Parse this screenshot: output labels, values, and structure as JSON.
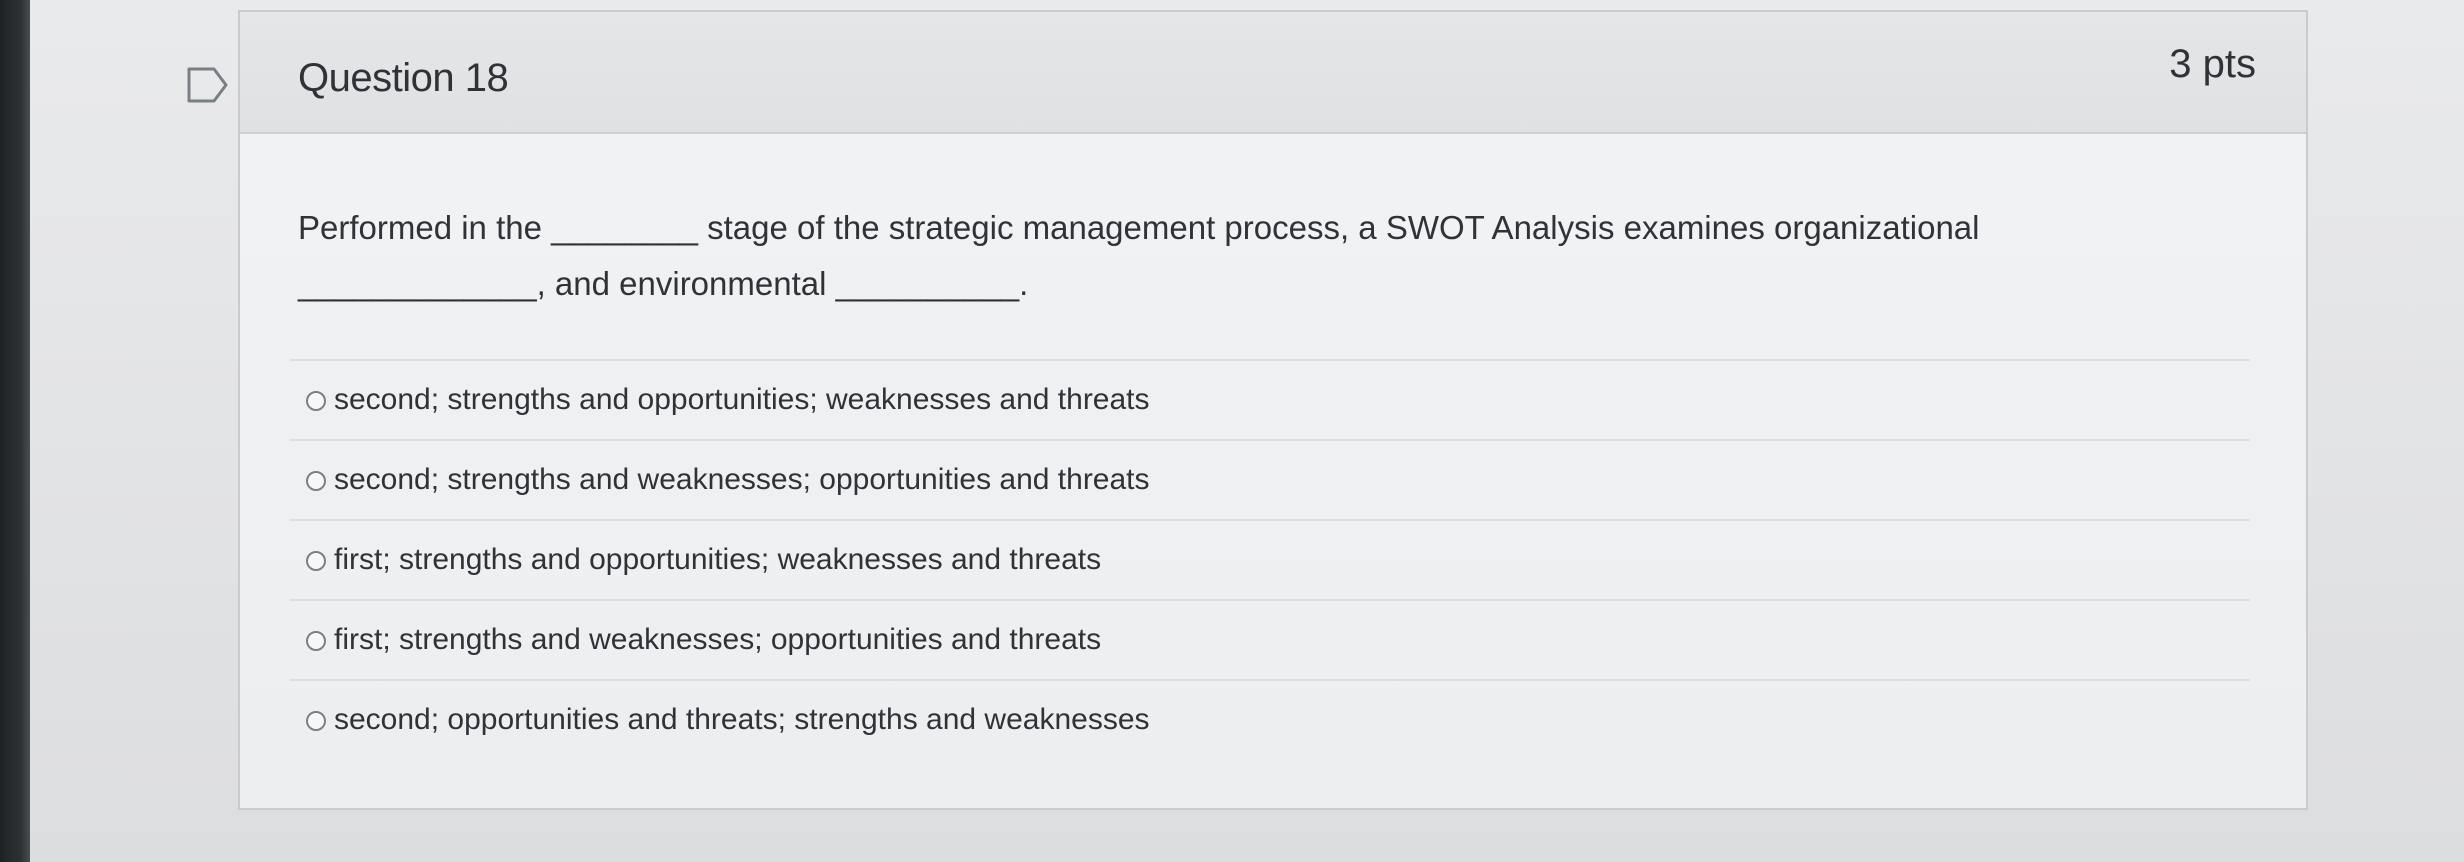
{
  "question": {
    "title": "Question 18",
    "points": "3 pts",
    "prompt": "Performed in the ________ stage of the strategic management process, a SWOT Analysis examines organizational\n_____________, and environmental __________.",
    "answers": [
      {
        "label": "second; strengths and opportunities; weaknesses and threats",
        "selected": false
      },
      {
        "label": "second; strengths and weaknesses; opportunities and threats",
        "selected": false
      },
      {
        "label": "first; strengths and opportunities; weaknesses and threats",
        "selected": false
      },
      {
        "label": "first; strengths and weaknesses; opportunities and threats",
        "selected": false
      },
      {
        "label": "second; opportunities and threats; strengths and weaknesses",
        "selected": false
      }
    ]
  },
  "icons": {
    "flag": "flag-question-icon",
    "radio": "radio-button-icon"
  },
  "colors": {
    "text": "#2f3338",
    "card_background": "#eef0f2",
    "header_background": "#e4e6e8",
    "border": "#c9cbcd"
  }
}
